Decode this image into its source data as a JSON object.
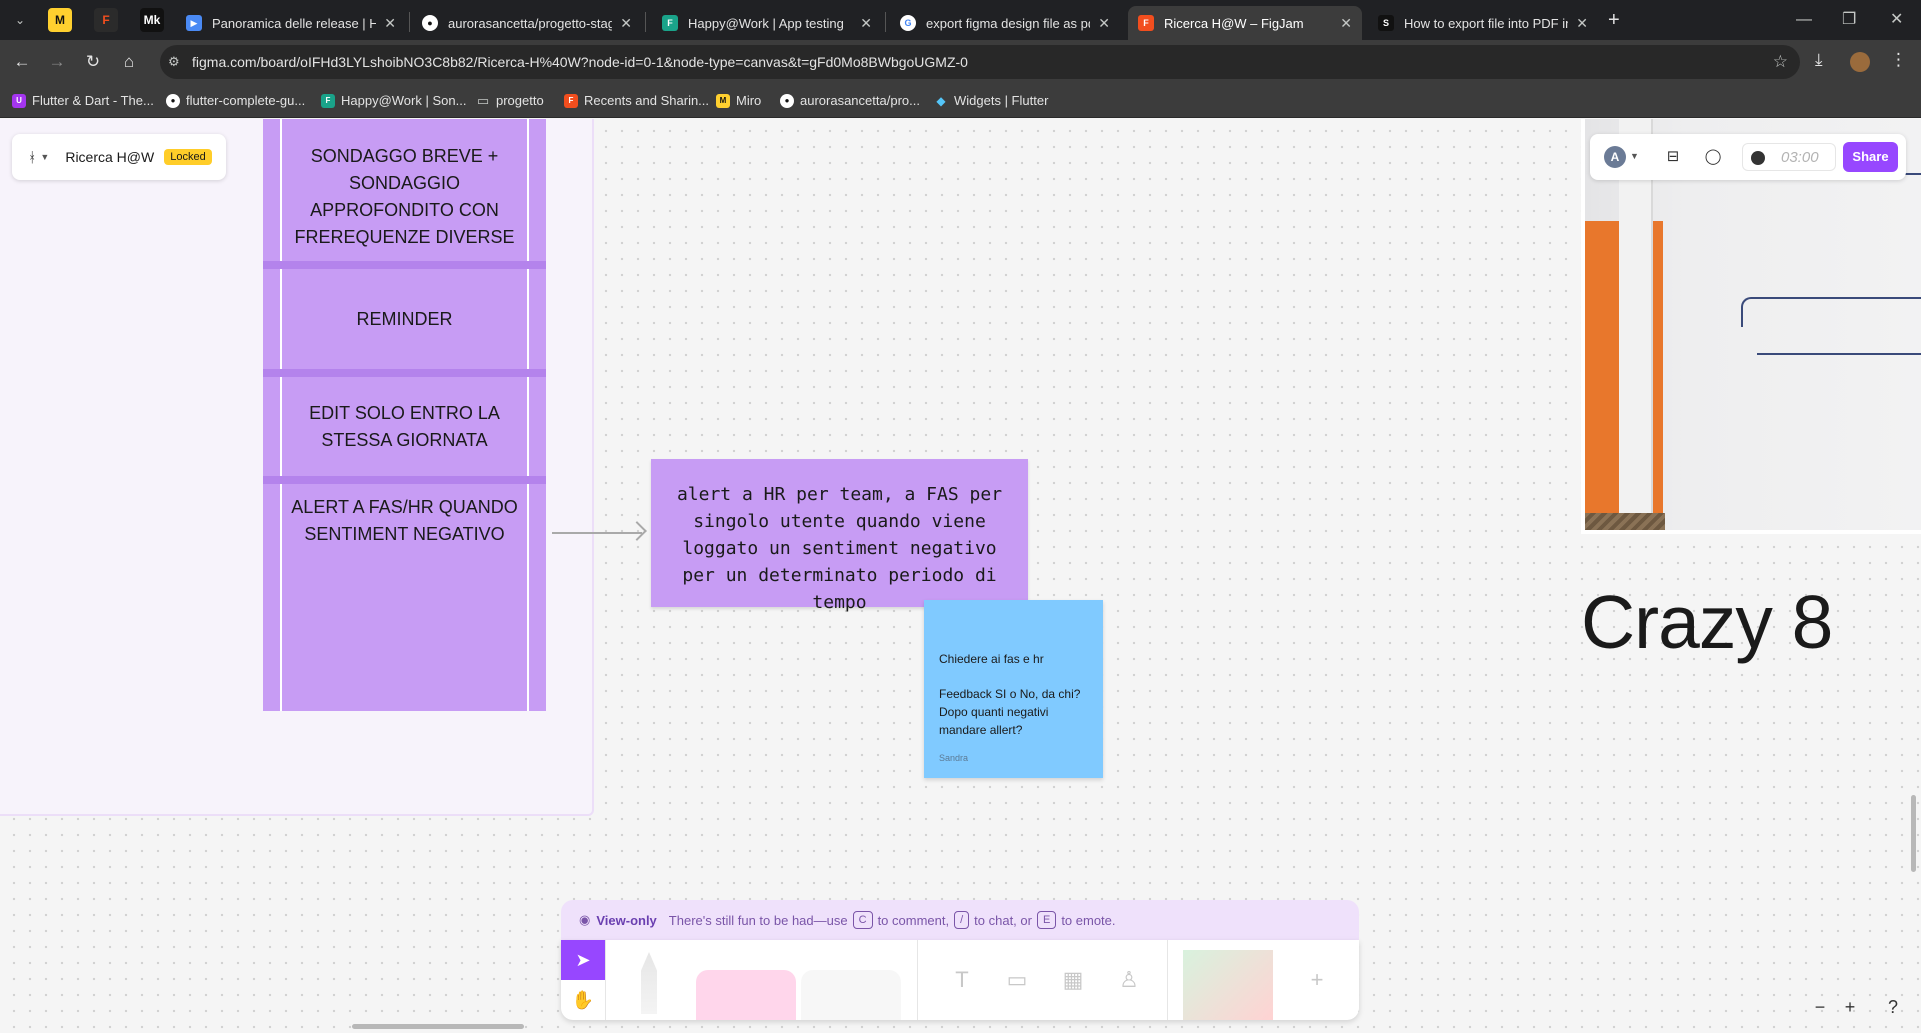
{
  "browser": {
    "tabs": [
      {
        "title": "Panoramica delle release | Happ",
        "icon": "google-play-console-icon",
        "color": "#4a8af4"
      },
      {
        "title": "aurorasancetta/progetto-stage",
        "icon": "github-icon",
        "color": "#ffffff"
      },
      {
        "title": "Happy@Work | App testing",
        "icon": "firebase-app-icon",
        "color": "#1aa38a"
      },
      {
        "title": "export figma design file as pdf",
        "icon": "google-icon",
        "color": "#ffffff"
      },
      {
        "title": "Ricerca H@W – FigJam",
        "icon": "figjam-icon",
        "color": "#f24e1e"
      },
      {
        "title": "How to export file into PDF in F",
        "icon": "site-icon",
        "color": "#111111"
      }
    ],
    "pinned": [
      {
        "icon": "miro-icon",
        "label": "M",
        "color": "#ffd02f"
      },
      {
        "icon": "figma-icon",
        "label": "F",
        "color": "#f24e1e"
      },
      {
        "icon": "medium-icon",
        "label": "Mk",
        "color": "#111111"
      }
    ],
    "url": "figma.com/board/oIFHd3LYLshoibNO3C8b82/Ricerca-H%40W?node-id=0-1&node-type=canvas&t=gFd0Mo8BWbgoUGMZ-0",
    "bookmarks": [
      {
        "label": "Flutter & Dart - The...",
        "icon": "udemy-icon",
        "color": "#a435f0"
      },
      {
        "label": "flutter-complete-gu...",
        "icon": "github-icon",
        "color": "#ffffff"
      },
      {
        "label": "Happy@Work | Son...",
        "icon": "figjam-icon",
        "color": "#1aa38a"
      },
      {
        "label": "progetto",
        "icon": "folder-icon",
        "color": "#c4c7c5"
      },
      {
        "label": "Recents and Sharin...",
        "icon": "figma-icon",
        "color": "#f24e1e"
      },
      {
        "label": "Miro",
        "icon": "miro-icon",
        "color": "#ffd02f"
      },
      {
        "label": "aurorasancetta/pro...",
        "icon": "github-icon",
        "color": "#ffffff"
      },
      {
        "label": "Widgets | Flutter",
        "icon": "flutter-icon",
        "color": "#54c5f8"
      }
    ]
  },
  "file": {
    "name": "Ricerca H@W",
    "badge": "Locked"
  },
  "table_cells": [
    "SONDAGGO BREVE + SONDAGGIO APPROFONDITO CON FREREQUENZE DIVERSE",
    "REMINDER",
    "EDIT SOLO ENTRO LA STESSA GIORNATA",
    "ALERT A FAS/HR QUANDO SENTIMENT NEGATIVO"
  ],
  "sticky_purple": "alert a HR per team, a FAS per singolo utente quando viene loggato un sentiment negativo per un determinato periodo di tempo",
  "sticky_blue": {
    "line1": "Chiedere ai fas e hr",
    "line2": "Feedback SI o No, da chi?",
    "line3": "Dopo quanti negativi mandare allert?",
    "author": "Sandra"
  },
  "heading": "Crazy 8",
  "collab": {
    "avatar": "A",
    "timer": "03:00",
    "share": "Share"
  },
  "view_only": {
    "label": "View-only",
    "text1": "There's still fun to be had—use",
    "key1": "C",
    "text2": "to comment,",
    "key2": "/",
    "text3": "to chat, or",
    "key3": "E",
    "text4": "to emote."
  },
  "accent": "#9747ff"
}
